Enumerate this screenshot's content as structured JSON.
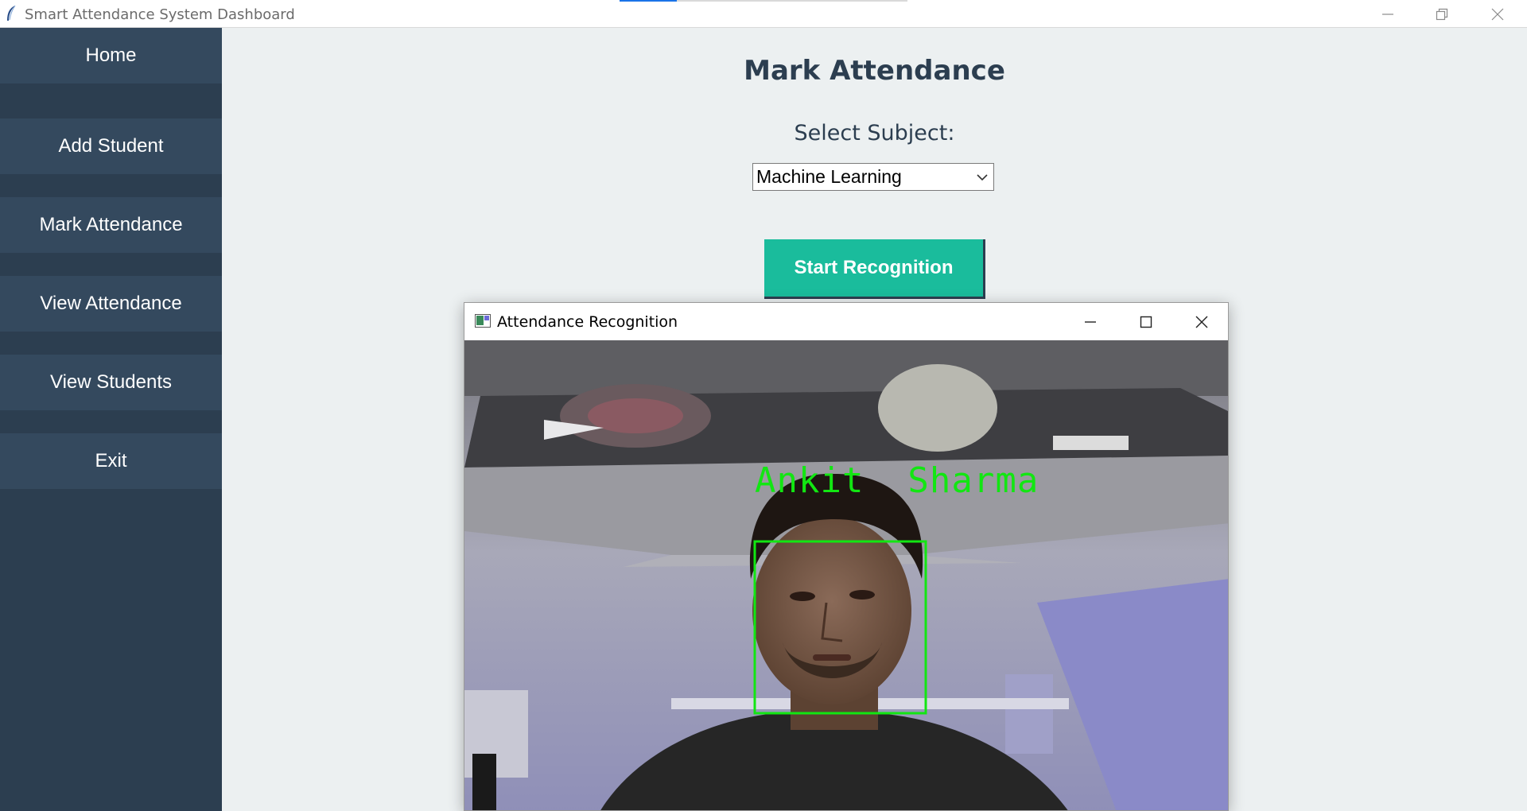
{
  "window": {
    "title": "Smart Attendance System Dashboard"
  },
  "sidebar": {
    "items": [
      {
        "label": "Home"
      },
      {
        "label": "Add Student"
      },
      {
        "label": "Mark Attendance"
      },
      {
        "label": "View Attendance"
      },
      {
        "label": "View Students"
      },
      {
        "label": "Exit"
      }
    ]
  },
  "main": {
    "title": "Mark Attendance",
    "subject_label": "Select Subject:",
    "subject_selected": "Machine Learning",
    "start_button": "Start Recognition"
  },
  "recognition": {
    "title": "Attendance Recognition",
    "detected_name": "Ankit  Sharma"
  },
  "colors": {
    "sidebar_bg": "#2c3e50",
    "nav_button_bg": "#34495e",
    "content_bg": "#ecf0f1",
    "accent": "#1abc9c",
    "detection_box": "#12e612"
  }
}
